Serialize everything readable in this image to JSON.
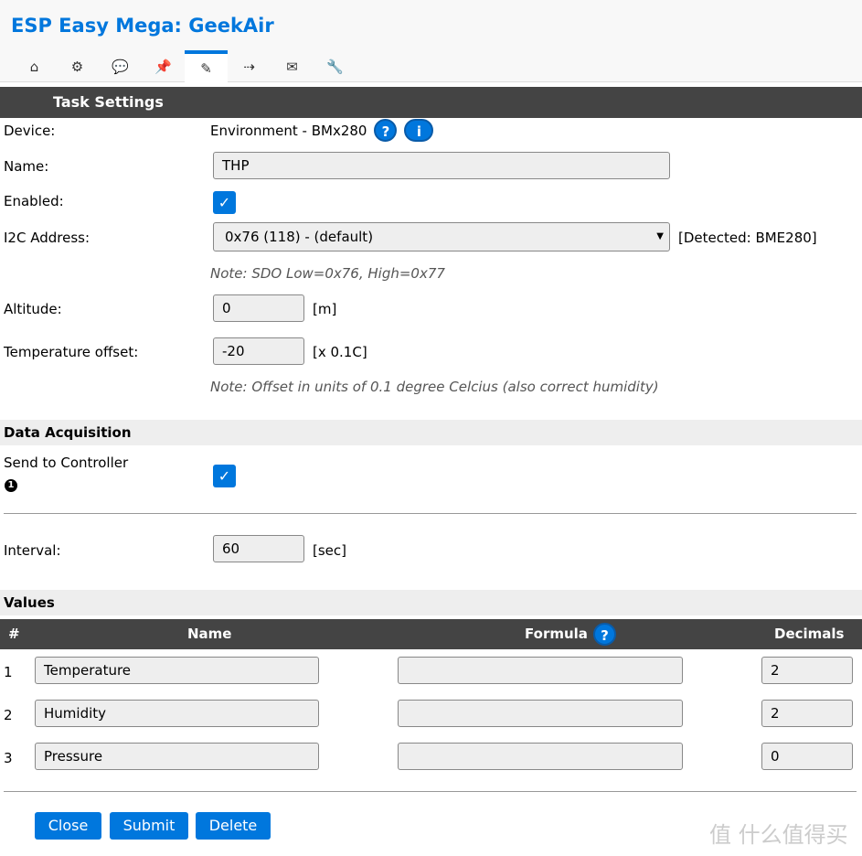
{
  "title": "ESP Easy Mega: GeekAir",
  "tabs": [
    {
      "icon": "home-icon",
      "glyph": "⌂"
    },
    {
      "icon": "gear-icon",
      "glyph": "⚙"
    },
    {
      "icon": "chat-icon",
      "glyph": "💬"
    },
    {
      "icon": "pin-icon",
      "glyph": "📌"
    },
    {
      "icon": "plug-icon",
      "glyph": "✎",
      "active": true
    },
    {
      "icon": "rules-icon",
      "glyph": "⇢"
    },
    {
      "icon": "mail-icon",
      "glyph": "✉"
    },
    {
      "icon": "wrench-icon",
      "glyph": "🔧"
    }
  ],
  "task_settings": "Task Settings",
  "device_label": "Device:",
  "device_value": "Environment - BMx280",
  "help": "?",
  "info": "i",
  "name_label": "Name:",
  "name_value": "THP",
  "enabled_label": "Enabled:",
  "check": "✓",
  "i2c_label": "I2C Address:",
  "i2c_value": "0x76 (118) - (default)",
  "i2c_detected": "[Detected: BME280]",
  "i2c_note": "Note: SDO Low=0x76, High=0x77",
  "altitude_label": "Altitude:",
  "altitude_value": "0",
  "altitude_unit": "[m]",
  "tempoff_label": "Temperature offset:",
  "tempoff_value": "-20",
  "tempoff_unit": "[x 0.1C]",
  "tempoff_note": "Note: Offset in units of 0.1 degree Celcius (also correct humidity)",
  "data_acq": "Data Acquisition",
  "send_label": "Send to Controller",
  "send_badge": "1",
  "interval_label": "Interval:",
  "interval_value": "60",
  "interval_unit": "[sec]",
  "values": "Values",
  "cols": {
    "num": "#",
    "name": "Name",
    "formula": "Formula",
    "decimals": "Decimals"
  },
  "rows": [
    {
      "n": "1",
      "name": "Temperature",
      "formula": "",
      "dec": "2"
    },
    {
      "n": "2",
      "name": "Humidity",
      "formula": "",
      "dec": "2"
    },
    {
      "n": "3",
      "name": "Pressure",
      "formula": "",
      "dec": "0"
    }
  ],
  "buttons": {
    "close": "Close",
    "submit": "Submit",
    "delete": "Delete"
  },
  "watermark": "值 什么值得买"
}
